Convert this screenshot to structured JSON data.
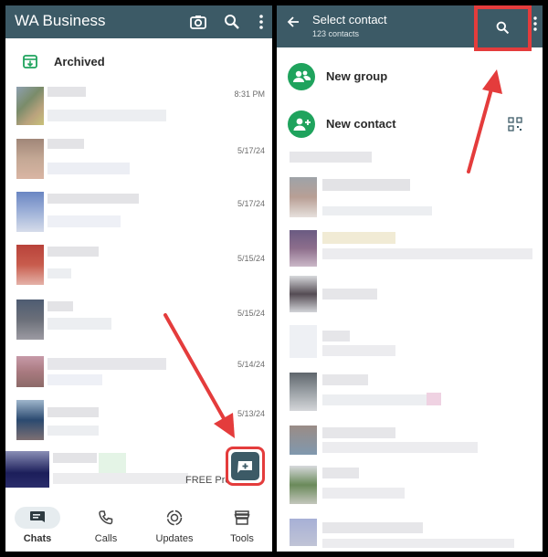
{
  "left_panel": {
    "app_title": "WA Business",
    "archived_label": "Archived",
    "chat_times": [
      "8:31 PM",
      "5/17/24",
      "5/17/24",
      "5/15/24",
      "5/15/24",
      "5/14/24",
      "5/13/24"
    ],
    "last_preview_text": "FREE Pro",
    "nav": [
      "Chats",
      "Calls",
      "Updates",
      "Tools"
    ]
  },
  "right_panel": {
    "title": "Select contact",
    "subtitle": "123 contacts",
    "actions": [
      "New group",
      "New contact"
    ]
  },
  "colors": {
    "header": "#3c5a66",
    "accent_green": "#1fa35d",
    "highlight_red": "#e43c3c"
  }
}
